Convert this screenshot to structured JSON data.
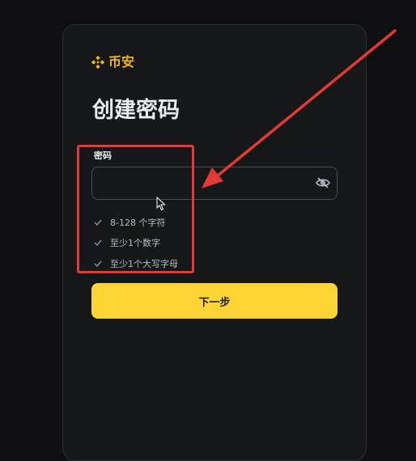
{
  "brand": {
    "name": "币安",
    "color": "#f0b90b"
  },
  "page_title": "创建密码",
  "password_field": {
    "label": "密码",
    "value": "",
    "toggle_icon": "eye-off-icon"
  },
  "requirements": [
    {
      "text": "8-128 个字符",
      "icon": "check-icon"
    },
    {
      "text": "至少1个数字",
      "icon": "check-icon"
    },
    {
      "text": "至少1个大写字母",
      "icon": "check-icon"
    }
  ],
  "next_button": {
    "label": "下一步",
    "color": "#fcd535"
  },
  "annotation": {
    "color": "#e53935"
  }
}
